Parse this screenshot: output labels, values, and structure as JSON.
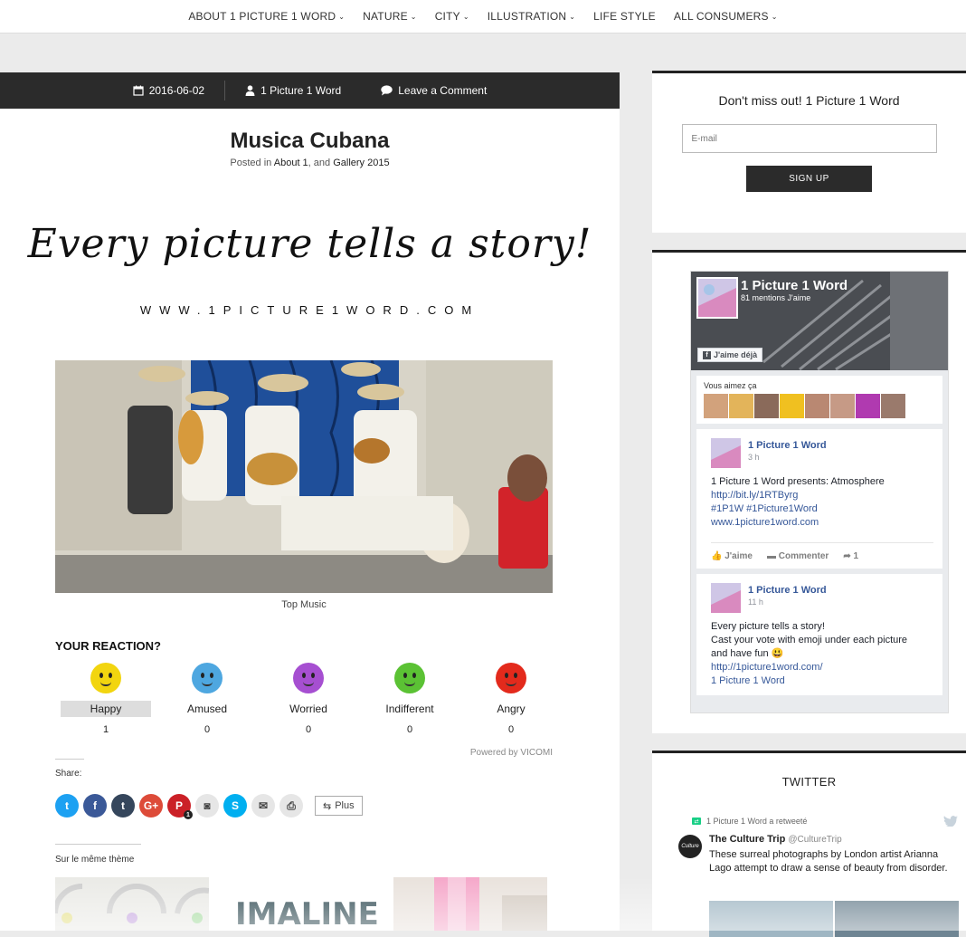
{
  "nav": {
    "items": [
      {
        "label": "ABOUT 1 PICTURE 1 WORD",
        "dropdown": true
      },
      {
        "label": "NATURE",
        "dropdown": true
      },
      {
        "label": "CITY",
        "dropdown": true
      },
      {
        "label": "ILLUSTRATION",
        "dropdown": true
      },
      {
        "label": "LIFE STYLE",
        "dropdown": false
      },
      {
        "label": "ALL CONSUMERS",
        "dropdown": true
      }
    ]
  },
  "post": {
    "date": "2016-06-02",
    "author": "1 Picture 1 Word",
    "comment_link": "Leave a Comment",
    "title": "Musica Cubana",
    "posted_prefix": "Posted in",
    "category_1": "About 1",
    "posted_join": ", and",
    "category_2": "Gallery 2015",
    "banner_script": "Every picture tells a story!",
    "banner_url": "WWW.1PICTURE1WORD.COM",
    "caption": "Top Music"
  },
  "reactions": {
    "title": "YOUR REACTION?",
    "items": [
      {
        "label": "Happy",
        "count": "1",
        "color": "#f2d50f",
        "selected": true
      },
      {
        "label": "Amused",
        "count": "0",
        "color": "#4ea7e0",
        "selected": false
      },
      {
        "label": "Worried",
        "count": "0",
        "color": "#a64fd1",
        "selected": false
      },
      {
        "label": "Indifferent",
        "count": "0",
        "color": "#5bc234",
        "selected": false
      },
      {
        "label": "Angry",
        "count": "0",
        "color": "#e32a1c",
        "selected": false
      }
    ],
    "powered_by": "Powered by VICOMI"
  },
  "share": {
    "title": "Share:",
    "buttons": [
      {
        "name": "twitter",
        "glyph": "t",
        "color": "#1da1f2"
      },
      {
        "name": "facebook",
        "glyph": "f",
        "color": "#3b5998"
      },
      {
        "name": "tumblr",
        "glyph": "t",
        "color": "#35465c"
      },
      {
        "name": "google-plus",
        "glyph": "G+",
        "color": "#dd4b39"
      },
      {
        "name": "pinterest",
        "glyph": "P",
        "color": "#cb2027",
        "badge": "1"
      },
      {
        "name": "instagram",
        "glyph": "◙",
        "color": "#e6e6e6"
      },
      {
        "name": "skype",
        "glyph": "S",
        "color": "#00aff0"
      },
      {
        "name": "email",
        "glyph": "✉",
        "color": "#e6e6e6"
      },
      {
        "name": "print",
        "glyph": "⎙",
        "color": "#e6e6e6"
      }
    ],
    "more_label": "Plus"
  },
  "related": {
    "title": "Sur le même thème",
    "item_2_text": "IMALINE"
  },
  "newsletter": {
    "title": "Don't miss out! 1 Picture 1 Word",
    "email_placeholder": "E-mail",
    "button_label": "SIGN UP"
  },
  "facebook": {
    "page_name": "1 Picture 1 Word",
    "likes": "81 mentions J'aime",
    "like_button": "J'aime déjà",
    "friends_title": "Vous aimez ça",
    "posts": [
      {
        "author": "1 Picture 1 Word",
        "time": "3 h",
        "lines": [
          "1 Picture 1 Word presents: Atmosphere"
        ],
        "links": [
          "http://bit.ly/1RTByrg",
          "#1P1W #1Picture1Word",
          "www.1picture1word.com"
        ],
        "like": "J'aime",
        "comment": "Commenter",
        "share_count": "1"
      },
      {
        "author": "1 Picture 1 Word",
        "time": "11 h",
        "lines": [
          "Every picture tells a story!",
          "Cast your vote with emoji under each picture",
          "and have fun 😃"
        ],
        "links": [
          "http://1picture1word.com/",
          "1 Picture 1 Word"
        ]
      }
    ]
  },
  "twitter": {
    "title": "TWITTER",
    "retweet_note": "1 Picture 1 Word a retweeté",
    "author": "The Culture Trip",
    "handle": "@CultureTrip",
    "avatar_text": "Culture",
    "text": "These surreal photographs by London artist Arianna Lago attempt to draw a sense of beauty from disorder."
  }
}
